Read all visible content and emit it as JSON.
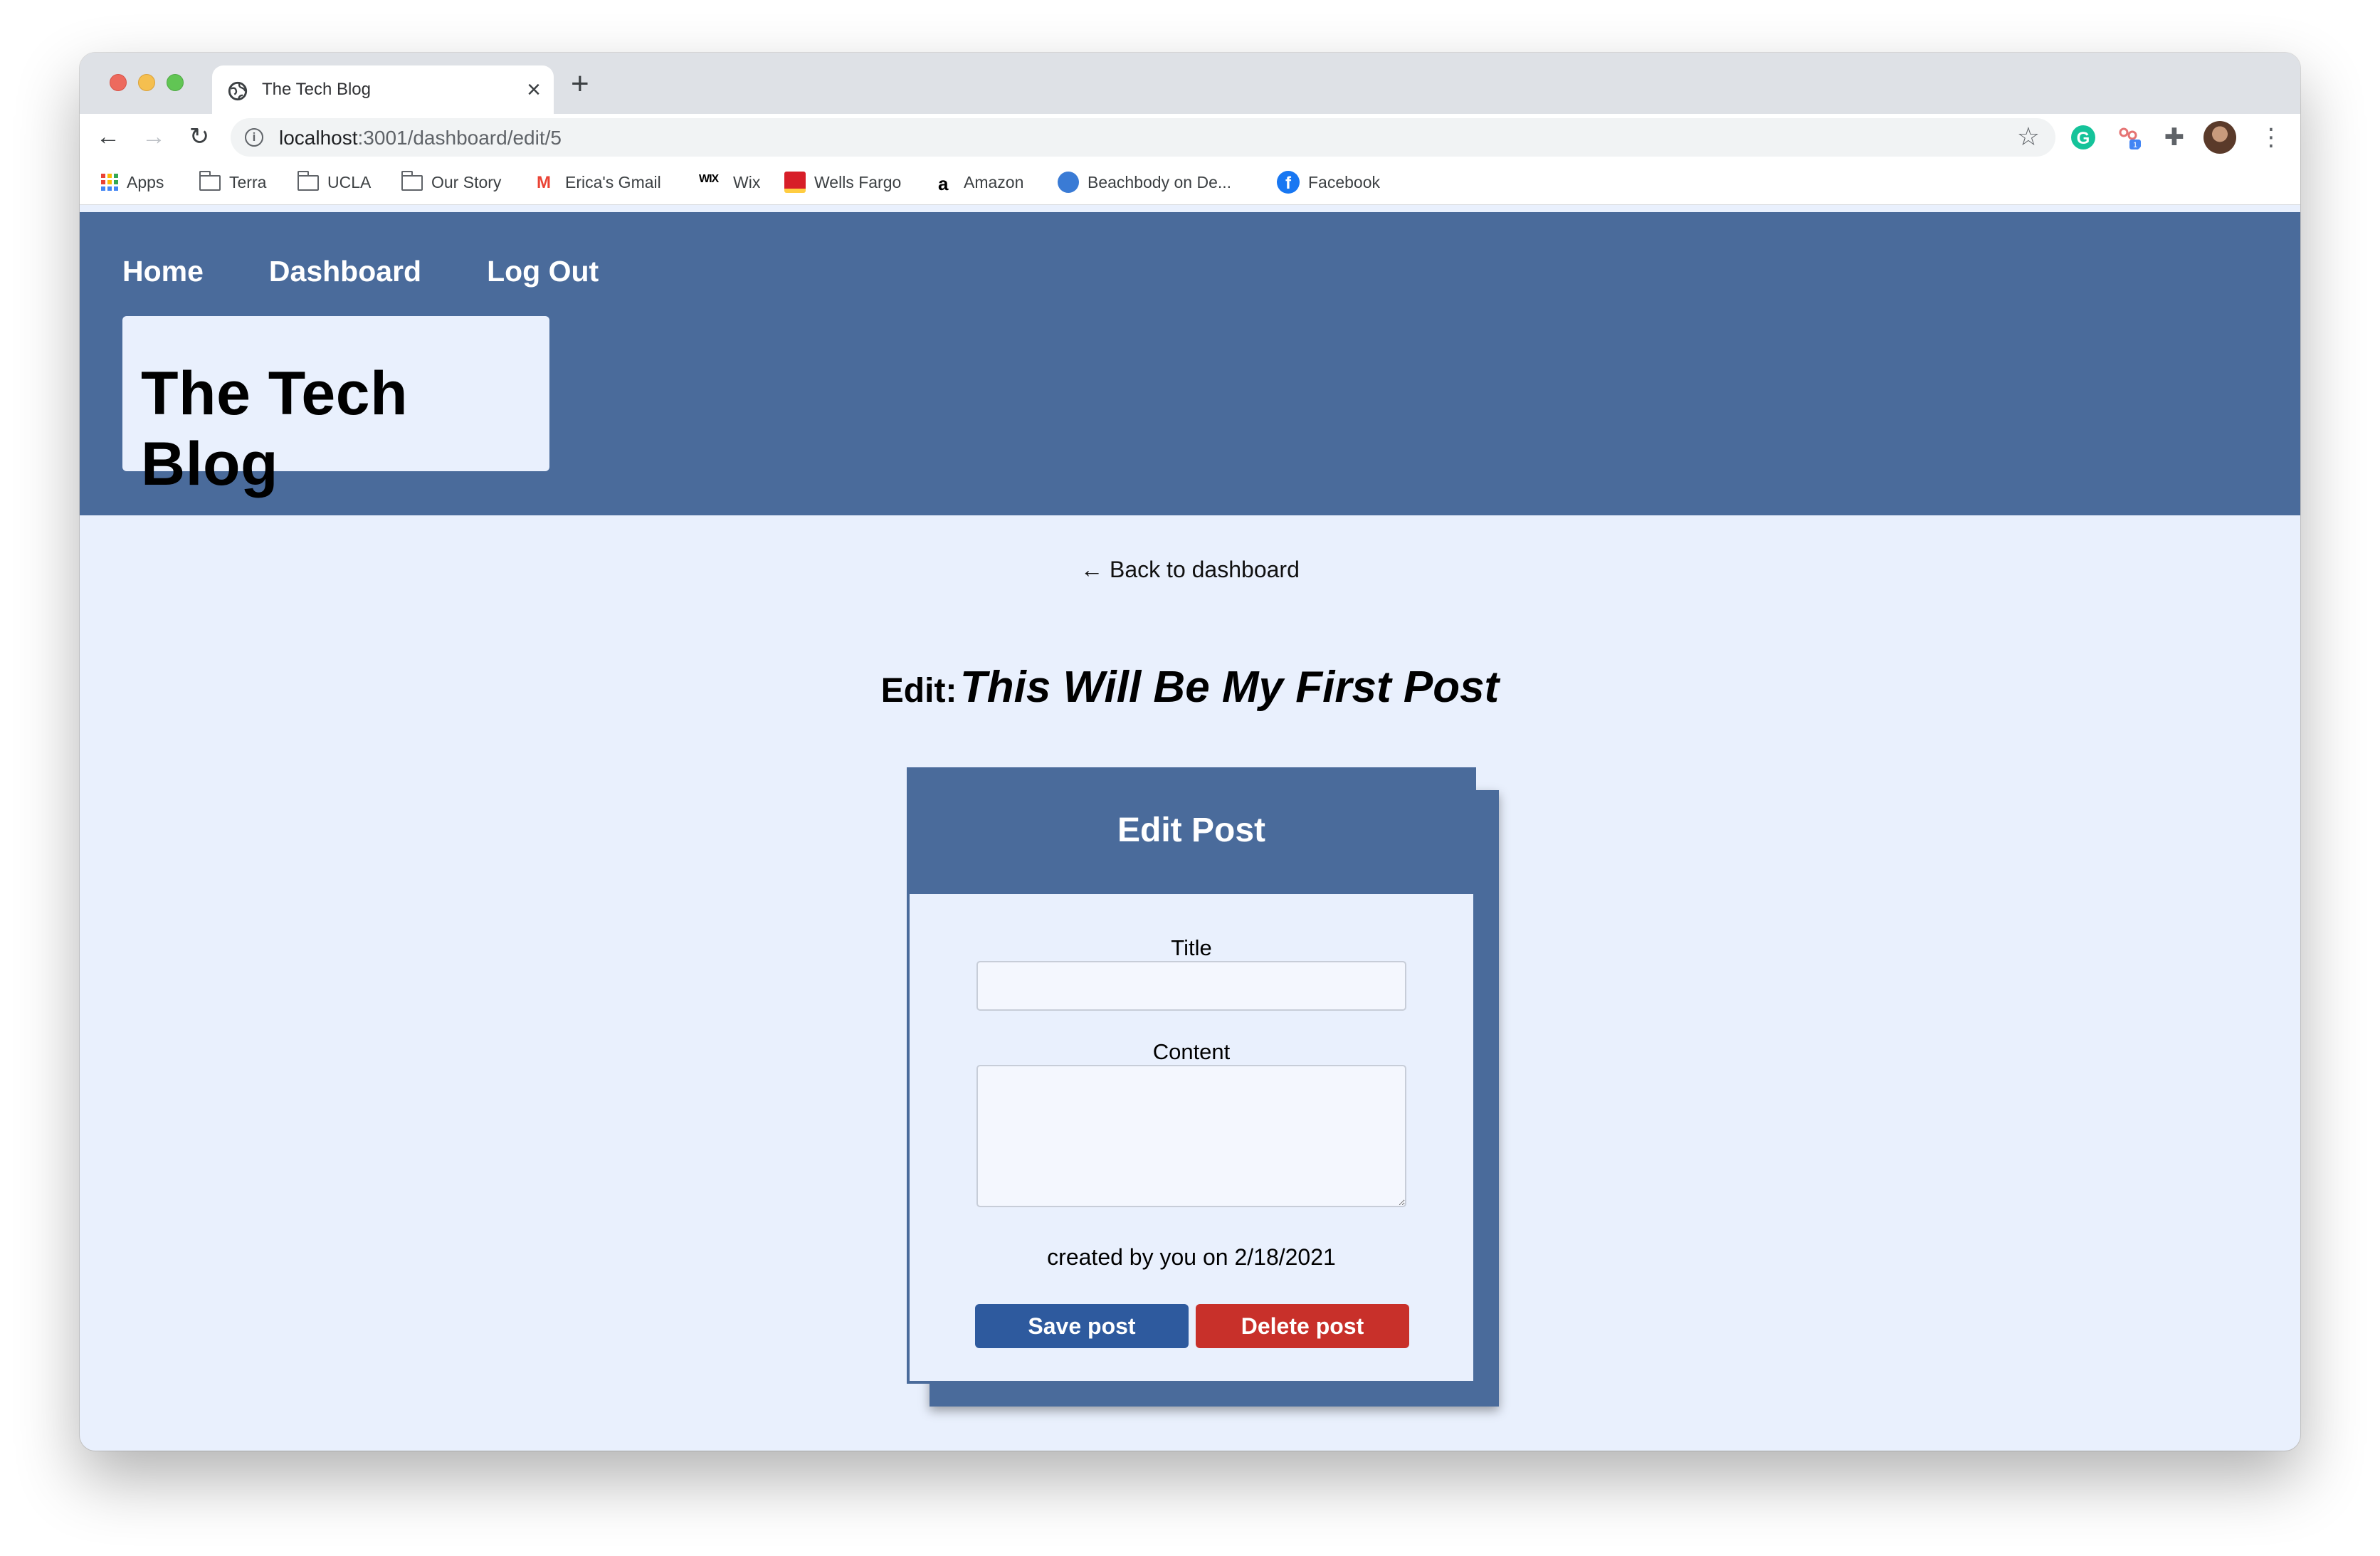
{
  "browser": {
    "tab_title": "The Tech Blog",
    "close_glyph": "×",
    "newtab_glyph": "+",
    "url_host": "localhost",
    "url_path": ":3001/dashboard/edit/5",
    "bookmarks": [
      {
        "label": "Apps",
        "icon": "apps-grid-icon"
      },
      {
        "label": "Terra",
        "icon": "folder-icon"
      },
      {
        "label": "UCLA",
        "icon": "folder-icon"
      },
      {
        "label": "Our Story",
        "icon": "folder-icon"
      },
      {
        "label": "Erica's Gmail",
        "icon": "gmail-icon"
      },
      {
        "label": "Wix",
        "icon": "wix-icon"
      },
      {
        "label": "Wells Fargo",
        "icon": "wells-fargo-icon"
      },
      {
        "label": "Amazon",
        "icon": "amazon-icon"
      },
      {
        "label": "Beachbody on De...",
        "icon": "beachbody-icon"
      },
      {
        "label": "Facebook",
        "icon": "facebook-icon"
      }
    ]
  },
  "site": {
    "nav": [
      "Home",
      "Dashboard",
      "Log Out"
    ],
    "logo": "The Tech Blog"
  },
  "main": {
    "back_link": "← Back to dashboard",
    "edit_label": "Edit:",
    "post_title": "This Will Be My First Post"
  },
  "card": {
    "header": "Edit Post",
    "title_label": "Title",
    "title_value": "",
    "content_label": "Content",
    "content_value": "",
    "created": "created by you on 2/18/2021",
    "save_label": "Save post",
    "delete_label": "Delete post"
  },
  "colors": {
    "header_bg": "#4a6b9b",
    "page_bg": "#e9f0fd",
    "save": "#2e5a9e",
    "delete": "#c8302a"
  }
}
